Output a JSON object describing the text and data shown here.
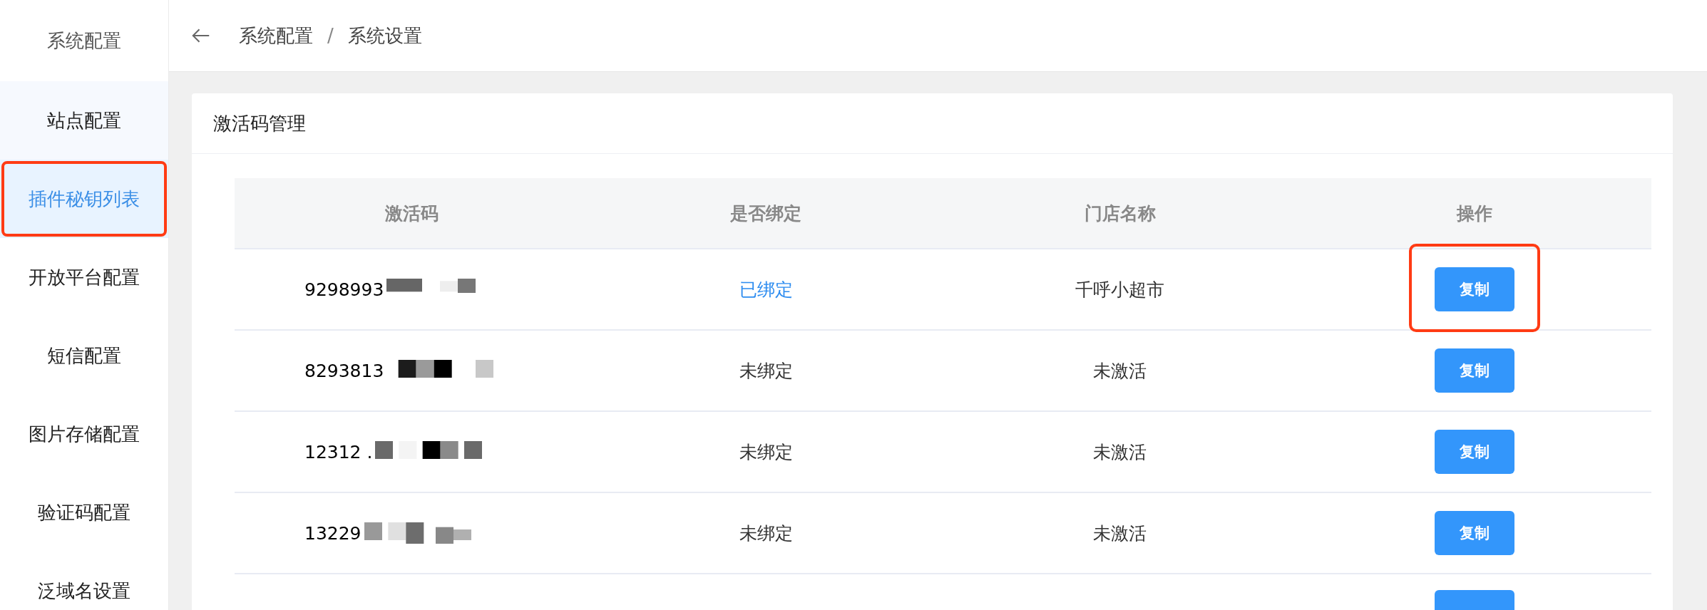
{
  "sidebar": {
    "title": "系统配置",
    "items": [
      {
        "label": "站点配置",
        "selected": false,
        "highlighted": false
      },
      {
        "label": "插件秘钥列表",
        "selected": true,
        "highlighted": true
      },
      {
        "label": "开放平台配置",
        "selected": false,
        "highlighted": false
      },
      {
        "label": "短信配置",
        "selected": false,
        "highlighted": false
      },
      {
        "label": "图片存储配置",
        "selected": false,
        "highlighted": false
      },
      {
        "label": "验证码配置",
        "selected": false,
        "highlighted": false
      },
      {
        "label": "泛域名设置",
        "selected": false,
        "highlighted": false
      }
    ]
  },
  "header": {
    "breadcrumb": [
      "系统配置",
      "系统设置"
    ],
    "separator": "/"
  },
  "card": {
    "title": "激活码管理",
    "table": {
      "columns": [
        "激活码",
        "是否绑定",
        "门店名称",
        "操作"
      ],
      "rows": [
        {
          "code": "9298993",
          "bound": true,
          "status": "已绑定",
          "store": "千呼小超市",
          "action": "复制",
          "highlighted": true
        },
        {
          "code": "8293813",
          "bound": false,
          "status": "未绑定",
          "store": "未激活",
          "action": "复制",
          "highlighted": false
        },
        {
          "code": "12312 .",
          "bound": false,
          "status": "未绑定",
          "store": "未激活",
          "action": "复制",
          "highlighted": false
        },
        {
          "code": "13229",
          "bound": false,
          "status": "未绑定",
          "store": "未激活",
          "action": "复制",
          "highlighted": false
        }
      ],
      "more_rows_below": true
    }
  }
}
